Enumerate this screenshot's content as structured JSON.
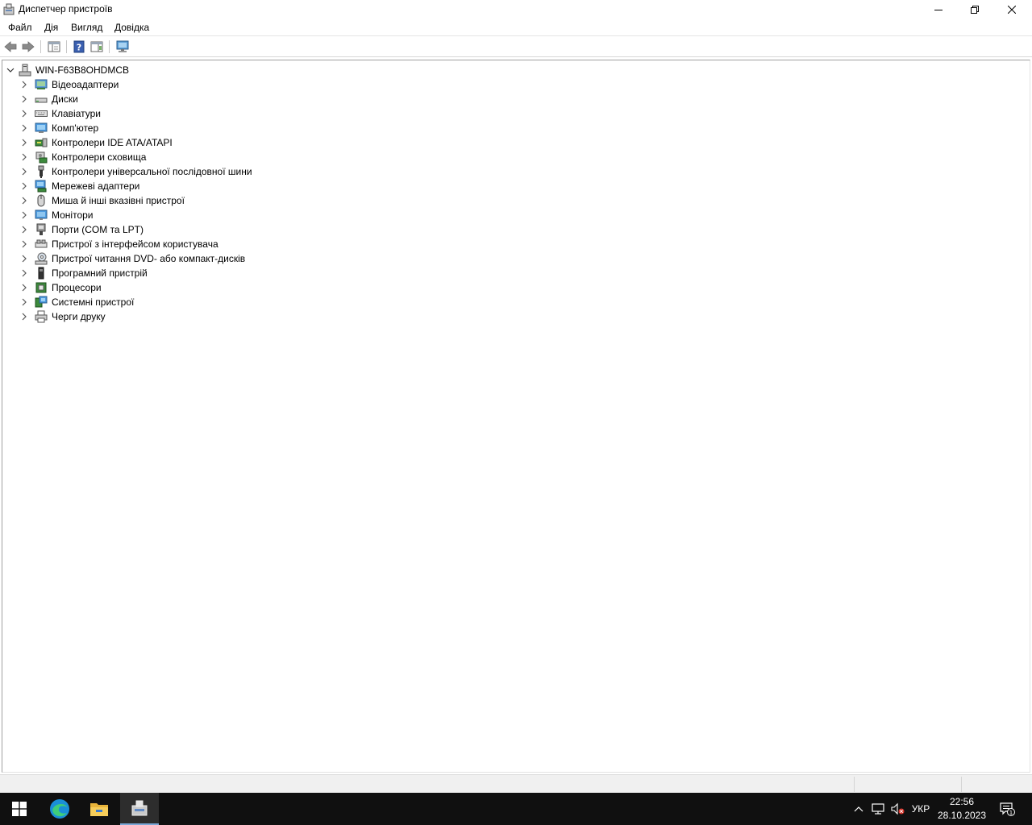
{
  "window": {
    "title": "Диспетчер пристроїв"
  },
  "menu": [
    "Файл",
    "Дія",
    "Вигляд",
    "Довідка"
  ],
  "toolbar": {
    "buttons": [
      "back-icon",
      "forward-icon",
      "properties-pane-icon",
      "help-icon",
      "action-pane-icon",
      "monitor-icon"
    ]
  },
  "tree": {
    "root": "WIN-F63B8OHDMCB",
    "categories": [
      {
        "label": "Відеоадаптери",
        "icon": "display-adapter-icon"
      },
      {
        "label": "Диски",
        "icon": "disk-drive-icon"
      },
      {
        "label": "Клавіатури",
        "icon": "keyboard-icon"
      },
      {
        "label": "Комп'ютер",
        "icon": "computer-icon"
      },
      {
        "label": "Контролери IDE ATA/ATAPI",
        "icon": "ide-controller-icon"
      },
      {
        "label": "Контролери сховища",
        "icon": "storage-controller-icon"
      },
      {
        "label": "Контролери універсальної послідовної шини",
        "icon": "usb-icon"
      },
      {
        "label": "Мережеві адаптери",
        "icon": "network-adapter-icon"
      },
      {
        "label": "Миша й інші вказівні пристрої",
        "icon": "mouse-icon"
      },
      {
        "label": "Монітори",
        "icon": "monitor-icon"
      },
      {
        "label": "Порти (COM та LPT)",
        "icon": "port-icon"
      },
      {
        "label": "Пристрої з інтерфейсом користувача",
        "icon": "hid-icon"
      },
      {
        "label": "Пристрої читання DVD- або компакт-дисків",
        "icon": "dvd-drive-icon"
      },
      {
        "label": "Програмний пристрій",
        "icon": "software-device-icon"
      },
      {
        "label": "Процесори",
        "icon": "processor-icon"
      },
      {
        "label": "Системні пристрої",
        "icon": "system-device-icon"
      },
      {
        "label": "Черги друку",
        "icon": "print-queue-icon"
      }
    ]
  },
  "taskbar": {
    "apps": [
      "start-icon",
      "edge-icon",
      "file-explorer-icon",
      "device-manager-icon"
    ],
    "language": "УКР",
    "time": "22:56",
    "date": "28.10.2023",
    "notification_count": "1"
  }
}
